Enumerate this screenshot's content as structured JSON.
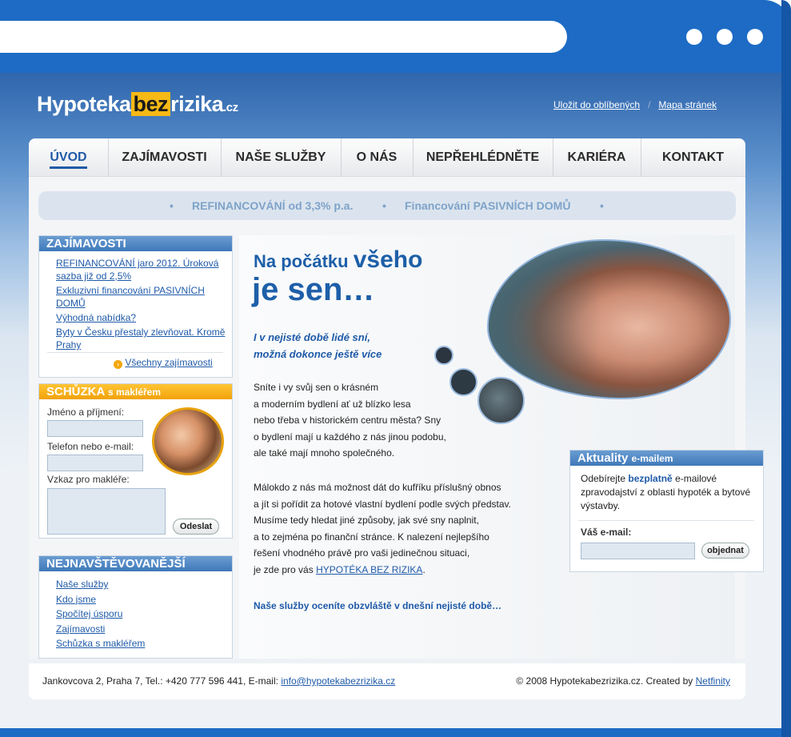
{
  "colors": {
    "frame": "#1d6bc5",
    "link": "#1f5aa8",
    "accent_orange": "#f6b916",
    "box_header_blue": "#4a82c0"
  },
  "logo": {
    "part1": "Hypoteka",
    "part2": "bez",
    "part3": "rizika",
    "tld": ".cz"
  },
  "top_links": [
    "Uložit do oblíbených",
    "Mapa stránek"
  ],
  "nav": [
    "ÚVOD",
    "ZAJÍMAVOSTI",
    "NAŠE SLUŽBY",
    "O NÁS",
    "NEPŘEHLÉDNĚTE",
    "KARIÉRA",
    "KONTAKT"
  ],
  "promo": {
    "item1": "REFINANCOVÁNÍ od 3,3% p.a.",
    "item2": "Financování PASIVNÍCH DOMŮ",
    "bullet": "•"
  },
  "news_box": {
    "title": "ZAJÍMAVOSTI",
    "items": [
      "REFINANCOVÁNÍ jaro 2012. Úroková sazba již od 2,5%",
      "Exkluzivní financování PASIVNÍCH DOMŮ",
      "Výhodná nabídka?",
      "Byty v Česku přestaly zlevňovat. Kromě Prahy"
    ],
    "all_link": "Všechny zajímavosti"
  },
  "meeting_box": {
    "title_main": "SCHŮZKA",
    "title_sub": "s makléřem",
    "name_label": "Jméno a příjmení:",
    "contact_label": "Telefon nebo e-mail:",
    "message_label": "Vzkaz pro makléře:",
    "submit": "Odeslat"
  },
  "popular_box": {
    "title": "NEJNAVŠTĚVOVANĚJŠÍ",
    "items": [
      "Naše služby",
      "Kdo jsme",
      "Spočítej úsporu",
      "Zajímavosti",
      "Schůzka s makléřem"
    ]
  },
  "main": {
    "heading1_small": "Na počátku",
    "heading1_big": "všeho",
    "heading2": "je sen…",
    "tagline1": "I v nejisté době lidé sní,",
    "tagline2": "možná dokonce ještě více",
    "para1": [
      "Sníte i vy svůj sen o krásném",
      "a moderním bydlení ať už blízko lesa",
      "nebo třeba v historickém centru města? Sny",
      "o bydlení mají u každého z nás jinou podobu,",
      "ale také mají mnoho společného."
    ],
    "para2": [
      "Málokdo z nás má možnost dát do kufříku příslušný obnos",
      "a jít si pořídit za hotové vlastní bydlení podle svých představ.",
      "Musíme tedy hledat jiné způsoby, jak své sny naplnit,",
      "a to zejména po finanční stránce. K nalezení nejlepšího",
      "řešení vhodného právě pro vaši jedinečnou situaci,"
    ],
    "para2_last_prefix": "je zde pro vás",
    "para2_link": "HYPOTÉKA BEZ RIZIKA",
    "para2_last_suffix": ".",
    "cta": "Naše služby oceníte obzvláště v dnešní nejisté době…"
  },
  "newsletter": {
    "title_main": "Aktuality",
    "title_sub": "e-mailem",
    "text_prefix": "Odebírejte",
    "text_bold": "bezplatně",
    "text_suffix": "e-mailové zpravodajství z oblasti hypoték a bytové výstavby.",
    "email_label": "Váš e-mail:",
    "submit": "objednat"
  },
  "footer": {
    "address": "Jankovcova 2, Praha 7, Tel.: +420 777 596 441, E-mail:",
    "email": "info@hypotekabezrizika.cz",
    "copyright": "© 2008 Hypotekabezrizika.cz. Created by",
    "creator": "Netfinity"
  }
}
